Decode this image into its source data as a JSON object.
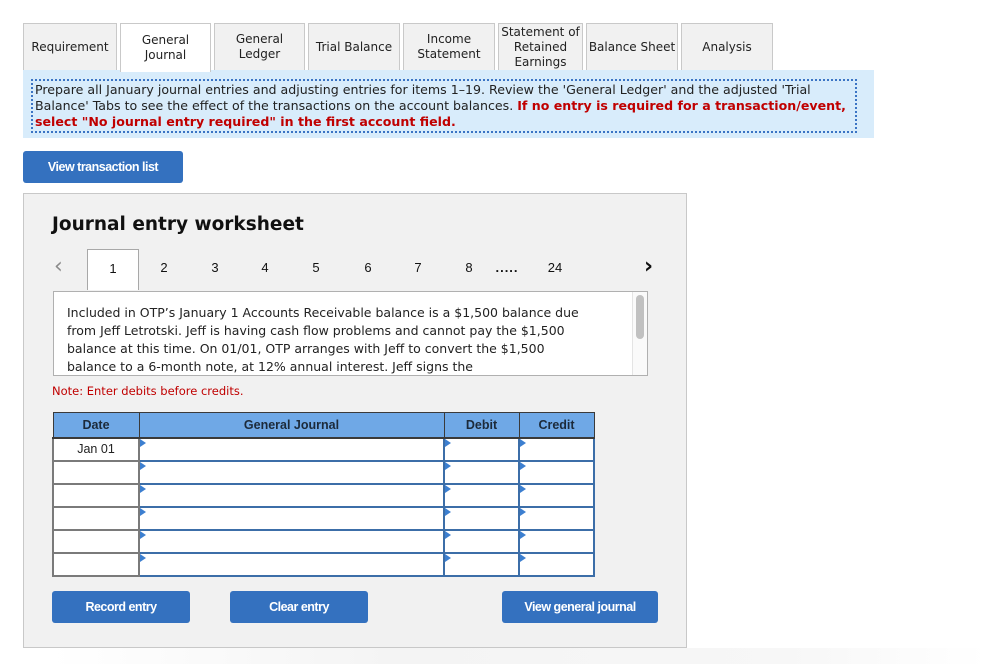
{
  "tabs": [
    {
      "label": "Requirement",
      "active": false
    },
    {
      "label": "General Journal",
      "active": true
    },
    {
      "label": "General Ledger",
      "active": false
    },
    {
      "label": "Trial Balance",
      "active": false
    },
    {
      "label": "Income Statement",
      "active": false
    },
    {
      "label": "Statement of Retained Earnings",
      "active": false
    },
    {
      "label": "Balance Sheet",
      "active": false
    },
    {
      "label": "Analysis",
      "active": false
    }
  ],
  "instructions": {
    "text": "Prepare all January journal entries and adjusting entries for items 1–19. Review the 'General Ledger' and the adjusted 'Trial Balance' Tabs to see the effect of the transactions on the account balances.",
    "emphasis": "If no entry is required for a transaction/event, select \"No journal entry required\" in the first account field."
  },
  "view_transaction_list_label": "View transaction list",
  "worksheet": {
    "title": "Journal entry worksheet",
    "pager": {
      "prev_icon": "chevron-left-icon",
      "next_icon": "chevron-right-icon",
      "pages": [
        "1",
        "2",
        "3",
        "4",
        "5",
        "6",
        "7",
        "8"
      ],
      "ellipsis": ".....",
      "last_page": "24",
      "current": "1"
    },
    "description": "Included in OTP’s January 1 Accounts Receivable balance is a $1,500 balance due from Jeff Letrotski. Jeff is having cash flow problems and cannot pay the $1,500 balance at this time. On 01/01, OTP arranges with Jeff to convert the $1,500 balance to a 6-month note, at 12% annual interest. Jeff signs the",
    "note": "Note: Enter debits before credits.",
    "table": {
      "headers": {
        "date": "Date",
        "account": "General Journal",
        "debit": "Debit",
        "credit": "Credit"
      },
      "rows": [
        {
          "date": "Jan 01",
          "account": "",
          "debit": "",
          "credit": ""
        },
        {
          "date": "",
          "account": "",
          "debit": "",
          "credit": ""
        },
        {
          "date": "",
          "account": "",
          "debit": "",
          "credit": ""
        },
        {
          "date": "",
          "account": "",
          "debit": "",
          "credit": ""
        },
        {
          "date": "",
          "account": "",
          "debit": "",
          "credit": ""
        },
        {
          "date": "",
          "account": "",
          "debit": "",
          "credit": ""
        }
      ]
    },
    "buttons": {
      "record": "Record entry",
      "clear": "Clear entry",
      "view_journal": "View general journal"
    }
  },
  "colors": {
    "button_blue": "#3471bf",
    "header_blue": "#6fa8e6",
    "instruction_bg": "#d8ecfb",
    "emphasis_red": "#c00000"
  }
}
